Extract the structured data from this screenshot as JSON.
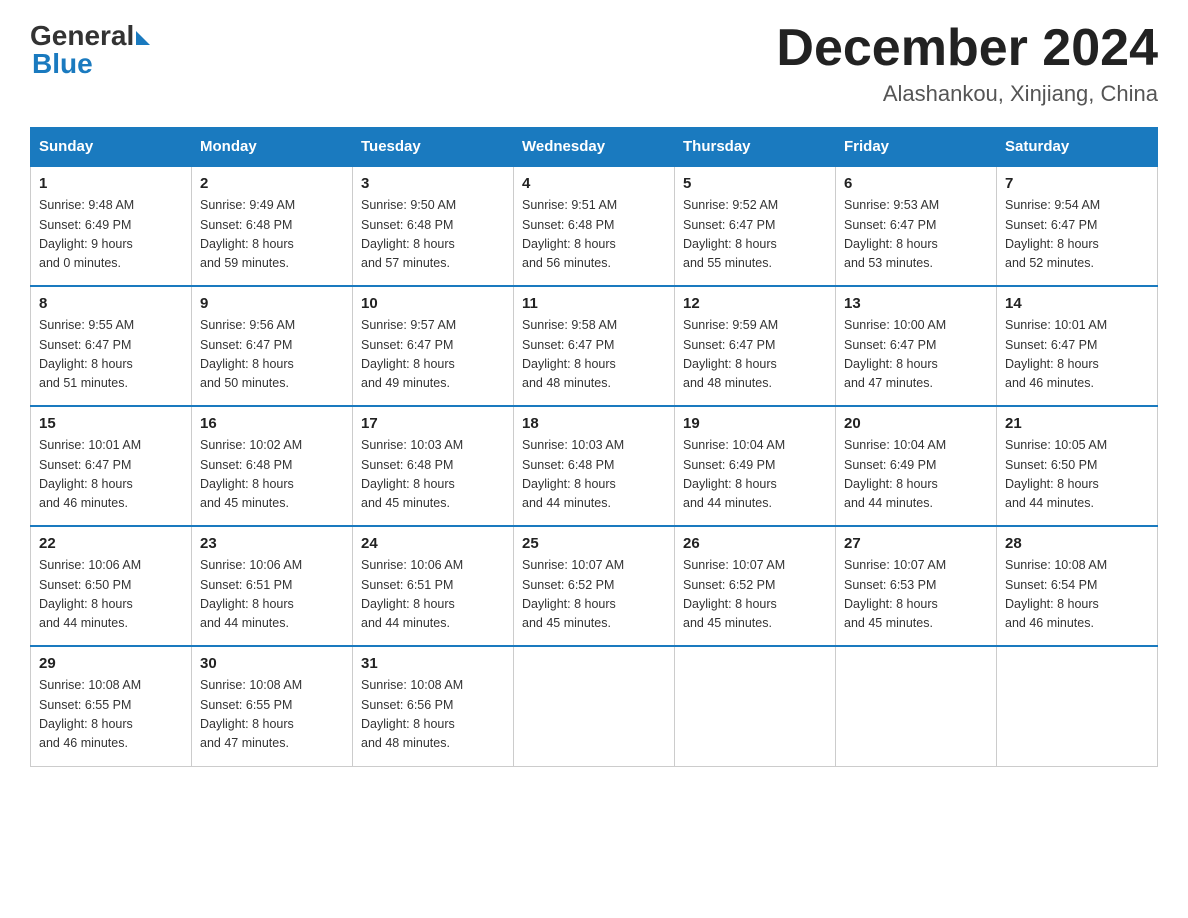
{
  "header": {
    "logo_general": "General",
    "logo_blue": "Blue",
    "month_title": "December 2024",
    "location": "Alashankou, Xinjiang, China"
  },
  "days_of_week": [
    "Sunday",
    "Monday",
    "Tuesday",
    "Wednesday",
    "Thursday",
    "Friday",
    "Saturday"
  ],
  "weeks": [
    [
      {
        "day": "1",
        "sunrise": "9:48 AM",
        "sunset": "6:49 PM",
        "daylight": "9 hours and 0 minutes."
      },
      {
        "day": "2",
        "sunrise": "9:49 AM",
        "sunset": "6:48 PM",
        "daylight": "8 hours and 59 minutes."
      },
      {
        "day": "3",
        "sunrise": "9:50 AM",
        "sunset": "6:48 PM",
        "daylight": "8 hours and 57 minutes."
      },
      {
        "day": "4",
        "sunrise": "9:51 AM",
        "sunset": "6:48 PM",
        "daylight": "8 hours and 56 minutes."
      },
      {
        "day": "5",
        "sunrise": "9:52 AM",
        "sunset": "6:47 PM",
        "daylight": "8 hours and 55 minutes."
      },
      {
        "day": "6",
        "sunrise": "9:53 AM",
        "sunset": "6:47 PM",
        "daylight": "8 hours and 53 minutes."
      },
      {
        "day": "7",
        "sunrise": "9:54 AM",
        "sunset": "6:47 PM",
        "daylight": "8 hours and 52 minutes."
      }
    ],
    [
      {
        "day": "8",
        "sunrise": "9:55 AM",
        "sunset": "6:47 PM",
        "daylight": "8 hours and 51 minutes."
      },
      {
        "day": "9",
        "sunrise": "9:56 AM",
        "sunset": "6:47 PM",
        "daylight": "8 hours and 50 minutes."
      },
      {
        "day": "10",
        "sunrise": "9:57 AM",
        "sunset": "6:47 PM",
        "daylight": "8 hours and 49 minutes."
      },
      {
        "day": "11",
        "sunrise": "9:58 AM",
        "sunset": "6:47 PM",
        "daylight": "8 hours and 48 minutes."
      },
      {
        "day": "12",
        "sunrise": "9:59 AM",
        "sunset": "6:47 PM",
        "daylight": "8 hours and 48 minutes."
      },
      {
        "day": "13",
        "sunrise": "10:00 AM",
        "sunset": "6:47 PM",
        "daylight": "8 hours and 47 minutes."
      },
      {
        "day": "14",
        "sunrise": "10:01 AM",
        "sunset": "6:47 PM",
        "daylight": "8 hours and 46 minutes."
      }
    ],
    [
      {
        "day": "15",
        "sunrise": "10:01 AM",
        "sunset": "6:47 PM",
        "daylight": "8 hours and 46 minutes."
      },
      {
        "day": "16",
        "sunrise": "10:02 AM",
        "sunset": "6:48 PM",
        "daylight": "8 hours and 45 minutes."
      },
      {
        "day": "17",
        "sunrise": "10:03 AM",
        "sunset": "6:48 PM",
        "daylight": "8 hours and 45 minutes."
      },
      {
        "day": "18",
        "sunrise": "10:03 AM",
        "sunset": "6:48 PM",
        "daylight": "8 hours and 44 minutes."
      },
      {
        "day": "19",
        "sunrise": "10:04 AM",
        "sunset": "6:49 PM",
        "daylight": "8 hours and 44 minutes."
      },
      {
        "day": "20",
        "sunrise": "10:04 AM",
        "sunset": "6:49 PM",
        "daylight": "8 hours and 44 minutes."
      },
      {
        "day": "21",
        "sunrise": "10:05 AM",
        "sunset": "6:50 PM",
        "daylight": "8 hours and 44 minutes."
      }
    ],
    [
      {
        "day": "22",
        "sunrise": "10:06 AM",
        "sunset": "6:50 PM",
        "daylight": "8 hours and 44 minutes."
      },
      {
        "day": "23",
        "sunrise": "10:06 AM",
        "sunset": "6:51 PM",
        "daylight": "8 hours and 44 minutes."
      },
      {
        "day": "24",
        "sunrise": "10:06 AM",
        "sunset": "6:51 PM",
        "daylight": "8 hours and 44 minutes."
      },
      {
        "day": "25",
        "sunrise": "10:07 AM",
        "sunset": "6:52 PM",
        "daylight": "8 hours and 45 minutes."
      },
      {
        "day": "26",
        "sunrise": "10:07 AM",
        "sunset": "6:52 PM",
        "daylight": "8 hours and 45 minutes."
      },
      {
        "day": "27",
        "sunrise": "10:07 AM",
        "sunset": "6:53 PM",
        "daylight": "8 hours and 45 minutes."
      },
      {
        "day": "28",
        "sunrise": "10:08 AM",
        "sunset": "6:54 PM",
        "daylight": "8 hours and 46 minutes."
      }
    ],
    [
      {
        "day": "29",
        "sunrise": "10:08 AM",
        "sunset": "6:55 PM",
        "daylight": "8 hours and 46 minutes."
      },
      {
        "day": "30",
        "sunrise": "10:08 AM",
        "sunset": "6:55 PM",
        "daylight": "8 hours and 47 minutes."
      },
      {
        "day": "31",
        "sunrise": "10:08 AM",
        "sunset": "6:56 PM",
        "daylight": "8 hours and 48 minutes."
      },
      null,
      null,
      null,
      null
    ]
  ]
}
